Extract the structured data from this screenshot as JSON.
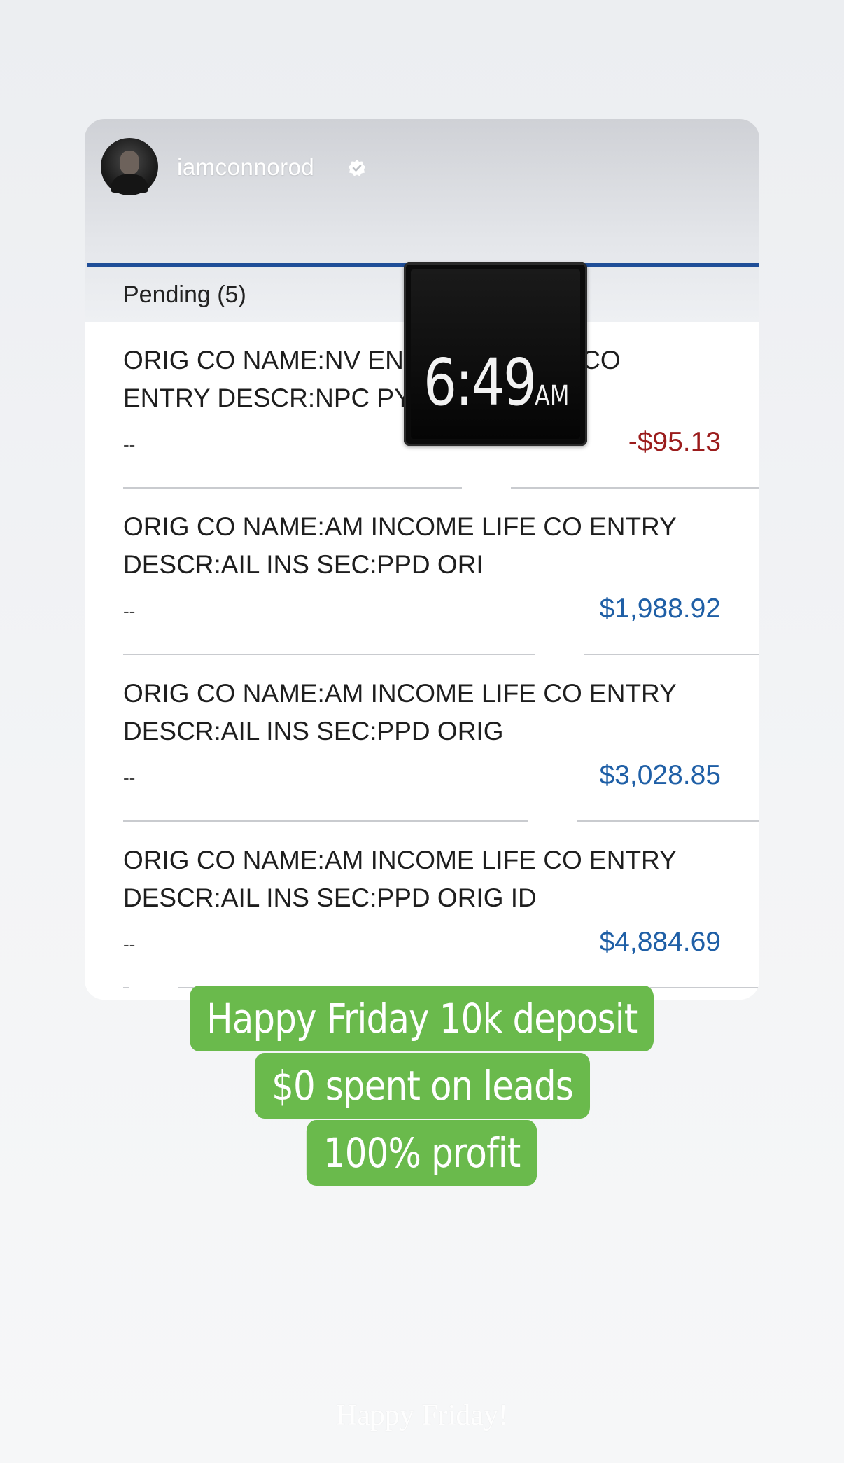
{
  "story": {
    "username": "iamconnorod",
    "clock": {
      "time": "6:49",
      "ampm": "AM"
    }
  },
  "bank": {
    "pending_label": "Pending (5)",
    "transactions": [
      {
        "description": "ORIG CO NAME:NV ENERGY SOUTH CO ENTRY DESCR:NPC PYMT",
        "date": "--",
        "amount": "-$95.13",
        "type": "debit"
      },
      {
        "description": "ORIG CO NAME:AM INCOME LIFE CO ENTRY DESCR:AIL INS SEC:PPD ORI",
        "date": "--",
        "amount": "$1,988.92",
        "type": "credit"
      },
      {
        "description": "ORIG CO NAME:AM INCOME LIFE CO ENTRY DESCR:AIL INS SEC:PPD ORIG",
        "date": "--",
        "amount": "$3,028.85",
        "type": "credit"
      },
      {
        "description": "ORIG CO NAME:AM INCOME LIFE CO ENTRY DESCR:AIL INS SEC:PPD ORIG ID",
        "date": "--",
        "amount": "$4,884.69",
        "type": "credit"
      }
    ]
  },
  "caption": {
    "lines": [
      "Happy Friday 10k deposit",
      "$0 spent on leads",
      "100% profit"
    ]
  },
  "watermark": "Happy Friday!",
  "colors": {
    "accent_rule": "#1f4e98",
    "debit": "#9b1c1c",
    "credit": "#1f5fa6",
    "caption_bg": "#6aba4c"
  }
}
